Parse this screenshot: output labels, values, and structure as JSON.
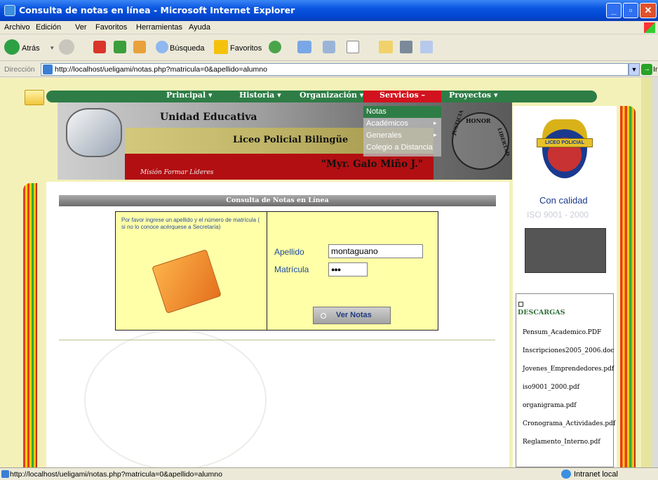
{
  "window": {
    "title": "Consulta de notas en línea - Microsoft Internet Explorer",
    "buttons": [
      "_",
      "▫",
      "✕"
    ]
  },
  "menubar": [
    "Archivo",
    "Edición",
    "Ver",
    "Favoritos",
    "Herramientas",
    "Ayuda"
  ],
  "toolbar": {
    "back": "Atrás",
    "search": "Búsqueda",
    "favorites": "Favoritos"
  },
  "address": {
    "label": "Dirección",
    "url": "http://localhost/ueligami/notas.php?matricula=0&apellido=alumno",
    "go": "Ir"
  },
  "site": {
    "nav": [
      "Principal",
      "Historia",
      "Organización",
      "Servicios",
      "Proyectos"
    ],
    "submenu": [
      "Notas",
      "Académicos",
      "Generales",
      "Colegio a Distancia"
    ],
    "banner": {
      "line1": "Unidad Educativa",
      "line2": "Liceo Policial Bilingüe",
      "line3": "\"Myr. Galo Miño J.\"",
      "mission": "Misión Formar Líderes",
      "seal_honor": "HONOR",
      "seal_justicia": "JUSTICIA",
      "seal_libertad": "LIBERTAD"
    },
    "crest_text": "LICEO POLICIAL",
    "quality": {
      "title": "Con calidad",
      "iso": "ISO 9001 - 2000"
    },
    "downloads": {
      "title": "DESCARGAS",
      "files": [
        "Pensum_Academico.PDF",
        "Inscripciones2005_2006.doc",
        "Jovenes_Emprendedores.pdf",
        "iso9001_2000.pdf",
        "organigrama.pdf",
        "Cronograma_Actividades.pdf",
        "Reglamento_Interno.pdf"
      ]
    },
    "form": {
      "header": "Consulta de Notas en Línea",
      "instructions": "Por favor ingrese un apellido y el número de matrícula ( si no lo conoce acérquese a Secretaría)",
      "apellido_label": "Apellido",
      "apellido_value": "montaguano",
      "matricula_label": "Matrícula",
      "matricula_value": "●●●",
      "submit": "Ver Notas"
    }
  },
  "status": {
    "url": "http://localhost/ueligami/notas.php?matricula=0&apellido=alumno",
    "zone": "Intranet local"
  },
  "colors": {
    "nav_green": "#2e7d46",
    "nav_active": "#d2121e",
    "page_yellow": "#f4f1b8",
    "form_bg": "#ffffa8"
  }
}
